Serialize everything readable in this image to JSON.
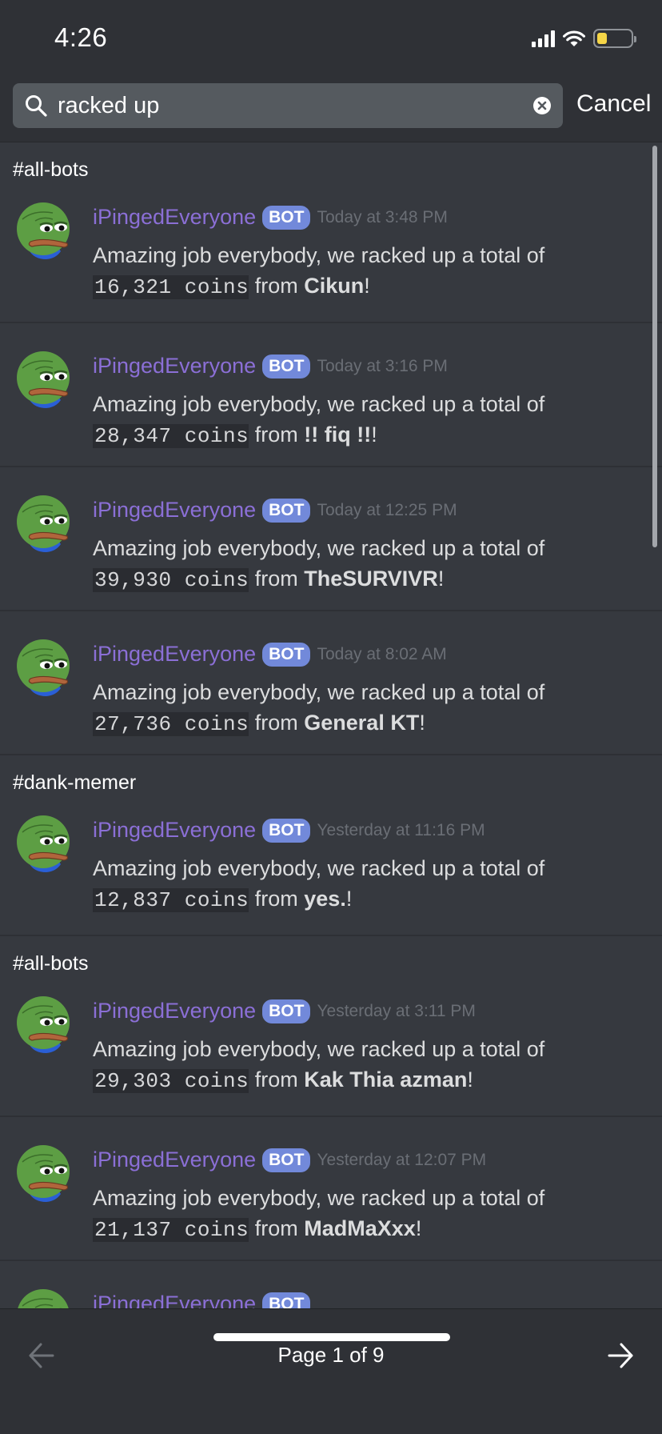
{
  "status_bar": {
    "time": "4:26",
    "signal_icon": "cellular-signal-icon",
    "wifi_icon": "wifi-icon",
    "battery_icon": "battery-low-icon",
    "battery_color": "#f5d547"
  },
  "search": {
    "value": "racked up",
    "placeholder": "Search",
    "cancel_label": "Cancel",
    "search_icon": "search-icon",
    "clear_icon": "clear-x-icon"
  },
  "colors": {
    "accent": "#7289da",
    "username": "#8b6fd6",
    "background": "#36393f",
    "header_bg": "#2f3136"
  },
  "results": [
    {
      "channel": "#all-bots",
      "messages": [
        {
          "username": "iPingedEveryone",
          "badge": "BOT",
          "timestamp": "Today at 3:48 PM",
          "text_prefix": "Amazing job everybody, we racked up a total of",
          "amount": "16,321 coins",
          "from_label": "from",
          "donor": "Cikun",
          "suffix": "!"
        },
        {
          "username": "iPingedEveryone",
          "badge": "BOT",
          "timestamp": "Today at 3:16 PM",
          "text_prefix": "Amazing job everybody, we racked up a total of",
          "amount": "28,347 coins",
          "from_label": "from",
          "donor": "!! fiq !!",
          "suffix": "!"
        },
        {
          "username": "iPingedEveryone",
          "badge": "BOT",
          "timestamp": "Today at 12:25 PM",
          "text_prefix": "Amazing job everybody, we racked up a total of",
          "amount": "39,930 coins",
          "from_label": "from",
          "donor": "TheSURVIVR",
          "suffix": "!"
        },
        {
          "username": "iPingedEveryone",
          "badge": "BOT",
          "timestamp": "Today at 8:02 AM",
          "text_prefix": "Amazing job everybody, we racked up a total of",
          "amount": "27,736 coins",
          "from_label": "from",
          "donor": "General KT",
          "suffix": "!"
        }
      ]
    },
    {
      "channel": "#dank-memer",
      "messages": [
        {
          "username": "iPingedEveryone",
          "badge": "BOT",
          "timestamp": "Yesterday at 11:16 PM",
          "text_prefix": "Amazing job everybody, we racked up a total of",
          "amount": "12,837 coins",
          "from_label": "from",
          "donor": "yes.",
          "suffix": "!"
        }
      ]
    },
    {
      "channel": "#all-bots",
      "messages": [
        {
          "username": "iPingedEveryone",
          "badge": "BOT",
          "timestamp": "Yesterday at 3:11 PM",
          "text_prefix": "Amazing job everybody, we racked up a total of",
          "amount": "29,303 coins",
          "from_label": "from",
          "donor": "Kak Thia azman",
          "suffix": "!"
        },
        {
          "username": "iPingedEveryone",
          "badge": "BOT",
          "timestamp": "Yesterday at 12:07 PM",
          "text_prefix": "Amazing job everybody, we racked up a total of",
          "amount": "21,137 coins",
          "from_label": "from",
          "donor": "MadMaXxx",
          "suffix": "!"
        },
        {
          "username": "iPingedEveryone",
          "badge": "BOT",
          "timestamp": "",
          "text_prefix": "",
          "amount": "",
          "from_label": "",
          "donor": "",
          "suffix": ""
        }
      ]
    }
  ],
  "pagination": {
    "label": "Page 1 of 9",
    "current_page": 1,
    "total_pages": 9,
    "prev_icon": "arrow-left-icon",
    "next_icon": "arrow-right-icon"
  }
}
